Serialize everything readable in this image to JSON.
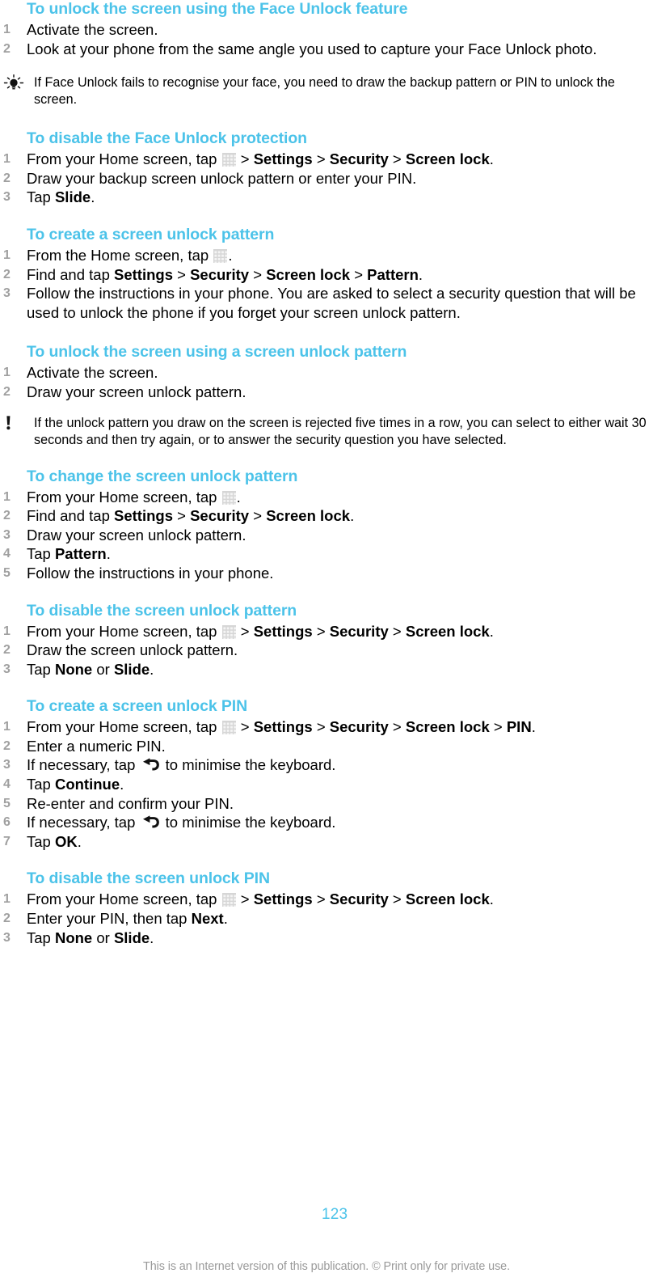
{
  "document": {
    "page_number": "123",
    "disclaimer": "This is an Internet version of this publication. © Print only for private use.",
    "heading_color": "#4cc3e9",
    "step_number_color": "#a0a0a0",
    "body_text_color": "#000000"
  },
  "sections": [
    {
      "id": "unlock-face-unlock",
      "heading": "To unlock the screen using the Face Unlock feature",
      "steps": [
        {
          "n": "1",
          "parts": [
            {
              "t": "Activate the screen."
            }
          ]
        },
        {
          "n": "2",
          "parts": [
            {
              "t": "Look at your phone from the same angle you used to capture your Face Unlock photo."
            }
          ]
        }
      ],
      "note": {
        "icon": "lightbulb-icon",
        "text": "If Face Unlock fails to recognise your face, you need to draw the backup pattern or PIN to unlock the screen."
      }
    },
    {
      "id": "disable-face-unlock",
      "heading": "To disable the Face Unlock protection",
      "steps": [
        {
          "n": "1",
          "parts": [
            {
              "t": "From your Home screen, tap "
            },
            {
              "icon": "app-drawer-grid-icon"
            },
            {
              "t": " "
            },
            {
              "sep": ">"
            },
            {
              "t": " "
            },
            {
              "b": "Settings"
            },
            {
              "t": " "
            },
            {
              "sep": ">"
            },
            {
              "t": " "
            },
            {
              "b": "Security"
            },
            {
              "t": " "
            },
            {
              "sep": ">"
            },
            {
              "t": " "
            },
            {
              "b": "Screen lock"
            },
            {
              "t": "."
            }
          ]
        },
        {
          "n": "2",
          "parts": [
            {
              "t": "Draw your backup screen unlock pattern or enter your PIN."
            }
          ]
        },
        {
          "n": "3",
          "parts": [
            {
              "t": "Tap "
            },
            {
              "b": "Slide"
            },
            {
              "t": "."
            }
          ]
        }
      ]
    },
    {
      "id": "create-unlock-pattern",
      "heading": "To create a screen unlock pattern",
      "steps": [
        {
          "n": "1",
          "parts": [
            {
              "t": "From the Home screen, tap "
            },
            {
              "icon": "app-drawer-grid-icon"
            },
            {
              "t": "."
            }
          ]
        },
        {
          "n": "2",
          "parts": [
            {
              "t": "Find and tap "
            },
            {
              "b": "Settings"
            },
            {
              "t": " "
            },
            {
              "sep": ">"
            },
            {
              "t": " "
            },
            {
              "b": "Security"
            },
            {
              "t": " "
            },
            {
              "sep": ">"
            },
            {
              "t": " "
            },
            {
              "b": "Screen lock"
            },
            {
              "t": " "
            },
            {
              "sep": ">"
            },
            {
              "t": " "
            },
            {
              "b": "Pattern"
            },
            {
              "t": "."
            }
          ]
        },
        {
          "n": "3",
          "parts": [
            {
              "t": "Follow the instructions in your phone. You are asked to select a security question that will be used to unlock the phone if you forget your screen unlock pattern."
            }
          ]
        }
      ]
    },
    {
      "id": "unlock-with-pattern",
      "heading": "To unlock the screen using a screen unlock pattern",
      "steps": [
        {
          "n": "1",
          "parts": [
            {
              "t": "Activate the screen."
            }
          ]
        },
        {
          "n": "2",
          "parts": [
            {
              "t": "Draw your screen unlock pattern."
            }
          ]
        }
      ],
      "note": {
        "icon": "exclamation-icon",
        "text": "If the unlock pattern you draw on the screen is rejected five times in a row, you can select to either wait 30 seconds and then try again, or to answer the security question you have selected."
      }
    },
    {
      "id": "change-unlock-pattern",
      "heading": "To change the screen unlock pattern",
      "steps": [
        {
          "n": "1",
          "parts": [
            {
              "t": "From your Home screen, tap "
            },
            {
              "icon": "app-drawer-grid-icon"
            },
            {
              "t": "."
            }
          ]
        },
        {
          "n": "2",
          "parts": [
            {
              "t": "Find and tap "
            },
            {
              "b": "Settings"
            },
            {
              "t": " "
            },
            {
              "sep": ">"
            },
            {
              "t": " "
            },
            {
              "b": "Security"
            },
            {
              "t": " "
            },
            {
              "sep": ">"
            },
            {
              "t": " "
            },
            {
              "b": "Screen lock"
            },
            {
              "t": "."
            }
          ]
        },
        {
          "n": "3",
          "parts": [
            {
              "t": "Draw your screen unlock pattern."
            }
          ]
        },
        {
          "n": "4",
          "parts": [
            {
              "t": "Tap "
            },
            {
              "b": "Pattern"
            },
            {
              "t": "."
            }
          ]
        },
        {
          "n": "5",
          "parts": [
            {
              "t": "Follow the instructions in your phone."
            }
          ]
        }
      ]
    },
    {
      "id": "disable-unlock-pattern",
      "heading": "To disable the screen unlock pattern",
      "steps": [
        {
          "n": "1",
          "parts": [
            {
              "t": "From your Home screen, tap "
            },
            {
              "icon": "app-drawer-grid-icon"
            },
            {
              "t": " "
            },
            {
              "sep": ">"
            },
            {
              "t": " "
            },
            {
              "b": "Settings"
            },
            {
              "t": " "
            },
            {
              "sep": ">"
            },
            {
              "t": " "
            },
            {
              "b": "Security"
            },
            {
              "t": " "
            },
            {
              "sep": ">"
            },
            {
              "t": " "
            },
            {
              "b": "Screen lock"
            },
            {
              "t": "."
            }
          ]
        },
        {
          "n": "2",
          "parts": [
            {
              "t": "Draw the screen unlock pattern."
            }
          ]
        },
        {
          "n": "3",
          "parts": [
            {
              "t": "Tap "
            },
            {
              "b": "None"
            },
            {
              "t": " or "
            },
            {
              "b": "Slide"
            },
            {
              "t": "."
            }
          ]
        }
      ]
    },
    {
      "id": "create-unlock-pin",
      "heading": "To create a screen unlock PIN",
      "steps": [
        {
          "n": "1",
          "parts": [
            {
              "t": "From your Home screen, tap "
            },
            {
              "icon": "app-drawer-grid-icon"
            },
            {
              "t": " "
            },
            {
              "sep": ">"
            },
            {
              "t": " "
            },
            {
              "b": "Settings"
            },
            {
              "t": " "
            },
            {
              "sep": ">"
            },
            {
              "t": " "
            },
            {
              "b": "Security"
            },
            {
              "t": " "
            },
            {
              "sep": ">"
            },
            {
              "t": " "
            },
            {
              "b": "Screen lock"
            },
            {
              "t": " "
            },
            {
              "sep": ">"
            },
            {
              "t": " "
            },
            {
              "b": "PIN"
            },
            {
              "t": "."
            }
          ]
        },
        {
          "n": "2",
          "parts": [
            {
              "t": "Enter a numeric PIN."
            }
          ]
        },
        {
          "n": "3",
          "parts": [
            {
              "t": "If necessary, tap "
            },
            {
              "icon": "back-arrow-icon"
            },
            {
              "t": " to minimise the keyboard."
            }
          ]
        },
        {
          "n": "4",
          "parts": [
            {
              "t": "Tap "
            },
            {
              "b": "Continue"
            },
            {
              "t": "."
            }
          ]
        },
        {
          "n": "5",
          "parts": [
            {
              "t": "Re-enter and confirm your PIN."
            }
          ]
        },
        {
          "n": "6",
          "parts": [
            {
              "t": "If necessary, tap "
            },
            {
              "icon": "back-arrow-icon"
            },
            {
              "t": " to minimise the keyboard."
            }
          ]
        },
        {
          "n": "7",
          "parts": [
            {
              "t": "Tap "
            },
            {
              "b": "OK"
            },
            {
              "t": "."
            }
          ]
        }
      ]
    },
    {
      "id": "disable-unlock-pin",
      "heading": "To disable the screen unlock PIN",
      "steps": [
        {
          "n": "1",
          "parts": [
            {
              "t": "From your Home screen, tap "
            },
            {
              "icon": "app-drawer-grid-icon"
            },
            {
              "t": " "
            },
            {
              "sep": ">"
            },
            {
              "t": " "
            },
            {
              "b": "Settings"
            },
            {
              "t": " "
            },
            {
              "sep": ">"
            },
            {
              "t": " "
            },
            {
              "b": "Security"
            },
            {
              "t": " "
            },
            {
              "sep": ">"
            },
            {
              "t": " "
            },
            {
              "b": "Screen lock"
            },
            {
              "t": "."
            }
          ]
        },
        {
          "n": "2",
          "parts": [
            {
              "t": "Enter your PIN, then tap "
            },
            {
              "b": "Next"
            },
            {
              "t": "."
            }
          ]
        },
        {
          "n": "3",
          "parts": [
            {
              "t": "Tap "
            },
            {
              "b": "None"
            },
            {
              "t": " or "
            },
            {
              "b": "Slide"
            },
            {
              "t": "."
            }
          ]
        }
      ]
    }
  ]
}
